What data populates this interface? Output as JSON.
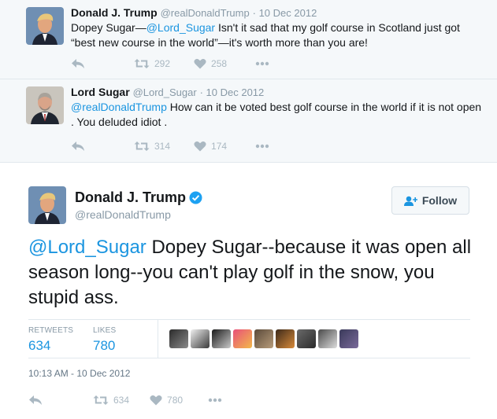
{
  "context_tweets": [
    {
      "name": "Donald J. Trump",
      "handle": "@realDonaldTrump",
      "date": "10 Dec 2012",
      "text_before": "Dopey Sugar—",
      "mention": "@Lord_Sugar",
      "text_after": "  Isn't it sad that my golf course in Scotland just got “best new course in the world”—it's worth more than you are!",
      "retweets": "292",
      "likes": "258"
    },
    {
      "name": "Lord Sugar",
      "handle": "@Lord_Sugar",
      "date": "10 Dec 2012",
      "mention": "@realDonaldTrump",
      "text_after": " How can it be voted best golf course in the world if it is not open . You deluded idiot .",
      "retweets": "314",
      "likes": "174"
    }
  ],
  "main_tweet": {
    "name": "Donald J. Trump",
    "handle": "@realDonaldTrump",
    "follow_label": "Follow",
    "mention": "@Lord_Sugar",
    "text": " Dopey Sugar--because it was open all season long--you can't play golf in the snow, you stupid ass.",
    "retweets_label": "RETWEETS",
    "retweets": "634",
    "likes_label": "LIKES",
    "likes": "780",
    "timestamp": "10:13 AM - 10 Dec 2012",
    "action_retweets": "634",
    "action_likes": "780"
  },
  "colors": {
    "link": "#1b95e0",
    "verified": "#1da1f2",
    "action_icon": "#aab8c2"
  },
  "liker_avatars": [
    "liker-1",
    "liker-2",
    "liker-3",
    "liker-4",
    "liker-5",
    "liker-6",
    "liker-7",
    "liker-8",
    "liker-9"
  ]
}
